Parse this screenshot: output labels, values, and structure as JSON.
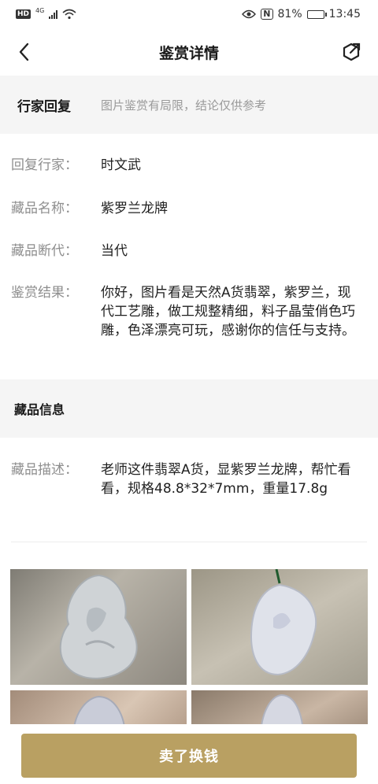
{
  "status_bar": {
    "hd": "HD",
    "network": "4G",
    "battery_pct": "81%",
    "battery_level": 0.81,
    "nfc": "N",
    "time": "13:45",
    "icons": [
      "signal-icon",
      "wifi-icon",
      "eye-icon",
      "nfc-icon",
      "battery-icon"
    ]
  },
  "nav": {
    "title": "鉴赏详情",
    "back_icon": "chevron-left-icon",
    "share_icon": "share-icon"
  },
  "reply": {
    "heading": "行家回复",
    "note": "图片鉴赏有局限，结论仅供参考",
    "rows": [
      {
        "label": "回复行家：",
        "value": "时文武"
      },
      {
        "label": "藏品名称：",
        "value": "紫罗兰龙牌"
      },
      {
        "label": "藏品断代：",
        "value": "当代"
      },
      {
        "label": "鉴赏结果：",
        "value": "你好，图片看是天然A货翡翠，紫罗兰，现代工艺雕，做工规整精细，料子晶莹俏色巧雕，色泽漂亮可玩，感谢你的信任与支持。"
      }
    ]
  },
  "info": {
    "heading": "藏品信息",
    "rows": [
      {
        "label": "藏品描述：",
        "value": "老师这件翡翠A货，显紫罗兰龙牌，帮忙看看，规格48.8*32*7mm，重量17.8g"
      }
    ]
  },
  "gallery": {
    "images": [
      "jade-pendant-photo-1",
      "jade-pendant-photo-2",
      "jade-pendant-photo-3",
      "jade-pendant-photo-4"
    ]
  },
  "cta": {
    "label": "卖了换钱",
    "color": "#b9a062"
  }
}
